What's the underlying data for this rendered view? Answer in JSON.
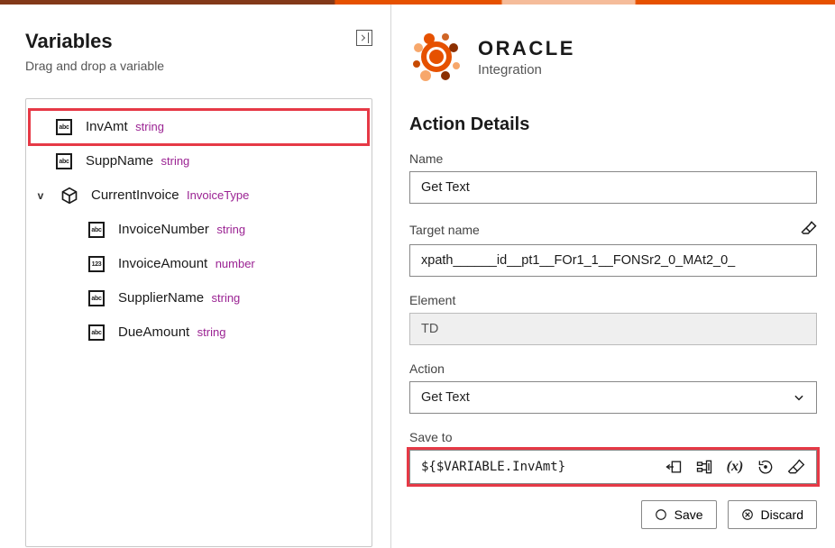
{
  "variables": {
    "title": "Variables",
    "subtitle": "Drag and drop a variable",
    "items": [
      {
        "name": "InvAmt",
        "type": "string",
        "icon": "abc"
      },
      {
        "name": "SuppName",
        "type": "string",
        "icon": "abc"
      },
      {
        "name": "CurrentInvoice",
        "type": "InvoiceType",
        "icon": "cube",
        "expanded": true,
        "children": [
          {
            "name": "InvoiceNumber",
            "type": "string",
            "icon": "abc"
          },
          {
            "name": "InvoiceAmount",
            "type": "number",
            "icon": "123"
          },
          {
            "name": "SupplierName",
            "type": "string",
            "icon": "abc"
          },
          {
            "name": "DueAmount",
            "type": "string",
            "icon": "abc"
          }
        ]
      }
    ]
  },
  "brand": {
    "name": "ORACLE",
    "product": "Integration"
  },
  "details": {
    "heading": "Action Details",
    "name_label": "Name",
    "name_value": "Get Text",
    "target_label": "Target name",
    "target_value": "xpath______id__pt1__FOr1_1__FONSr2_0_MAt2_0_",
    "element_label": "Element",
    "element_value": "TD",
    "action_label": "Action",
    "action_value": "Get Text",
    "saveto_label": "Save to",
    "saveto_value": "${$VARIABLE.InvAmt}"
  },
  "buttons": {
    "save": "Save",
    "discard": "Discard"
  }
}
